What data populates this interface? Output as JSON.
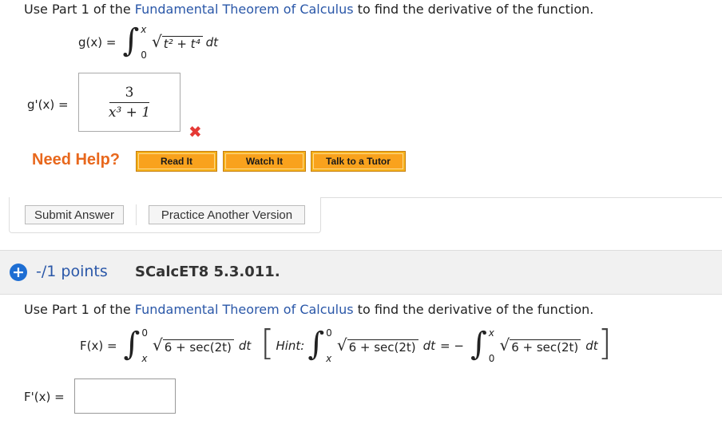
{
  "q1": {
    "instr_pre": "Use Part 1 of the ",
    "instr_link": "Fundamental Theorem of Calculus",
    "instr_post": " to find the derivative of the function.",
    "fn_label": "g(x) =",
    "upper": "x",
    "lower": "0",
    "radicand": "t² + t⁴",
    "dt": "dt",
    "deriv_label": "g'(x) =",
    "answer": {
      "numerator": "3",
      "denominator": "x³ + 1"
    },
    "result_mark": "✖",
    "need_help": "Need Help?",
    "help_buttons": [
      "Read It",
      "Watch It",
      "Talk to a Tutor"
    ],
    "submit": "Submit Answer",
    "practice": "Practice Another Version"
  },
  "q2": {
    "points": "-/1 points",
    "id": "SCalcET8 5.3.011.",
    "instr_pre": "Use Part 1 of the ",
    "instr_link": "Fundamental Theorem of Calculus",
    "instr_post": " to find the derivative of the function.",
    "fn_label": "F(x) =",
    "upper": "0",
    "lower": "x",
    "radicand": "6 + sec(2t)",
    "dt": "dt",
    "hint_label": "Hint:",
    "hint_eq": "= −",
    "hint_upper2": "x",
    "hint_lower2": "0",
    "deriv_label": "F'(x) =",
    "answer_value": ""
  },
  "colors": {
    "link": "#2a57a8",
    "need_help": "#e8681d",
    "wrong": "#e53935",
    "button_orange": "#f9a21d",
    "plus_icon": "#1e6ed3"
  }
}
